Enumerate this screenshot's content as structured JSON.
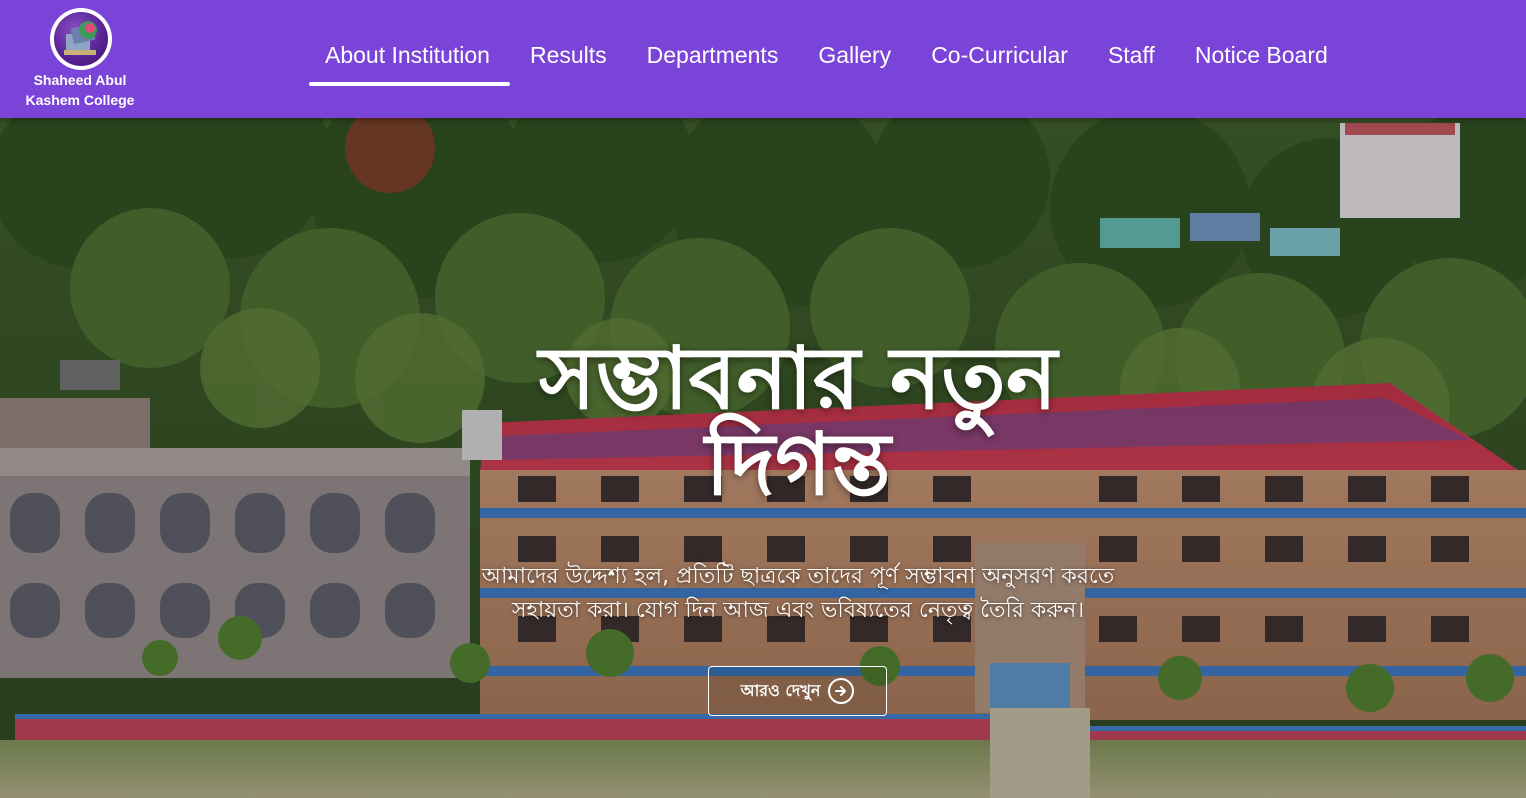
{
  "brand": {
    "name_line1": "Shaheed Abul",
    "name_line2": "Kashem College",
    "logo_icon": "college-emblem-icon"
  },
  "nav": {
    "items": [
      {
        "label": "About Institution",
        "active": true
      },
      {
        "label": "Results",
        "active": false
      },
      {
        "label": "Departments",
        "active": false
      },
      {
        "label": "Gallery",
        "active": false
      },
      {
        "label": "Co-Curricular",
        "active": false
      },
      {
        "label": "Staff",
        "active": false
      },
      {
        "label": "Notice Board",
        "active": false
      }
    ]
  },
  "hero": {
    "title_line1": "সম্ভাবনার নতুন",
    "title_line2": "দিগন্ত",
    "subtitle_line1": "আমাদের উদ্দেশ্য হল, প্রতিটি ছাত্রকে তাদের পূর্ণ সম্ভাবনা অনুসরণ করতে",
    "subtitle_line2": "সহায়তা করা। যোগ দিন আজ এবং ভবিষ্যতের নেতৃত্ব তৈরি করুন।",
    "button_label": "আরও দেখুন",
    "button_icon": "arrow-right-circle-icon"
  },
  "colors": {
    "header_bg": "#7b44d8",
    "text": "#ffffff"
  }
}
